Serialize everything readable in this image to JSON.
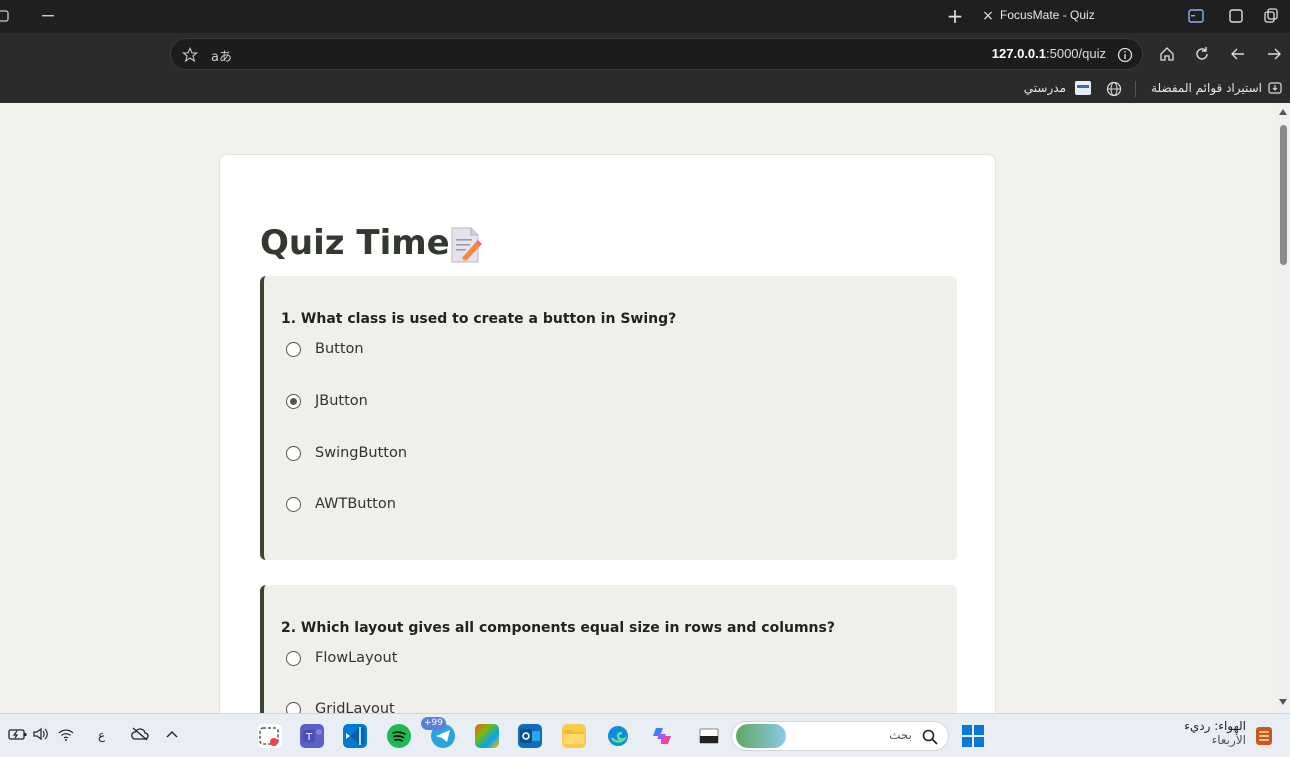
{
  "browser": {
    "tab_title": "FocusMate - Quiz",
    "url_host": "127.0.0.1",
    "url_path": ":5000/quiz",
    "url_lang": "aあ",
    "new_tab": "+",
    "tab_close": "×",
    "bookmarks": {
      "import": "استيراد قوائم المفضلة",
      "school": "مدرستي"
    }
  },
  "quiz": {
    "title": "Quiz Time",
    "questions": [
      {
        "text": "1. What class is used to create a button in Swing?",
        "options": [
          "Button",
          "JButton",
          "SwingButton",
          "AWTButton"
        ],
        "selected": 1
      },
      {
        "text": "2. Which layout gives all components equal size in rows and columns?",
        "options": [
          "FlowLayout",
          "GridLayout"
        ],
        "selected": null
      }
    ]
  },
  "taskbar": {
    "search_placeholder": "بحث",
    "weather_line1": "الهواء: رديء",
    "weather_line2": "الأربعاء",
    "lang": "ع",
    "telegram_badge": "+99"
  },
  "colors": {
    "accent": "#3a4632",
    "page_bg": "#f3f1ec",
    "question_bg": "#f0efea"
  }
}
